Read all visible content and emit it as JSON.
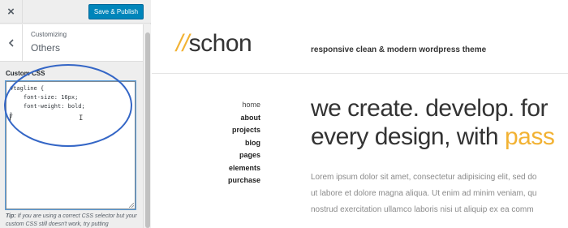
{
  "customizer": {
    "close_label": "×",
    "save_label": "Save & Publish",
    "section": {
      "customizing_label": "Customizing",
      "title": "Others"
    },
    "custom_css": {
      "label": "Custom CSS",
      "code_lines": [
        "#tagline {",
        "    font-size: 16px;",
        "    font-weight: bold;",
        "}"
      ]
    },
    "tip": {
      "prefix": "Tip:",
      "text": " If you are using a correct CSS selector but your custom CSS still doesn't work, try putting"
    }
  },
  "preview": {
    "logo_mark": "//",
    "logo_text": "schon",
    "tagline": "responsive clean & modern wordpress theme",
    "nav": [
      "home",
      "about",
      "projects",
      "blog",
      "pages",
      "elements",
      "purchase"
    ],
    "hero_line1": "we create. develop. for",
    "hero_line2_prefix": "every design, with ",
    "hero_line2_accent": "pass",
    "body_lines": [
      "Lorem ipsum dolor sit amet, consectetur adipisicing elit, sed do",
      "ut labore et dolore magna aliqua. Ut enim ad minim veniam, qu",
      "nostrud exercitation ullamco laboris nisi ut aliquip ex ea comm"
    ]
  },
  "colors": {
    "primary_button": "#0085ba",
    "accent": "#f2b233",
    "annotation_ellipse": "#3466c6"
  },
  "icons": {
    "close": "close-icon",
    "back": "chevron-left-icon",
    "text_cursor": "text-cursor-icon",
    "resize": "resize-grip-icon"
  }
}
